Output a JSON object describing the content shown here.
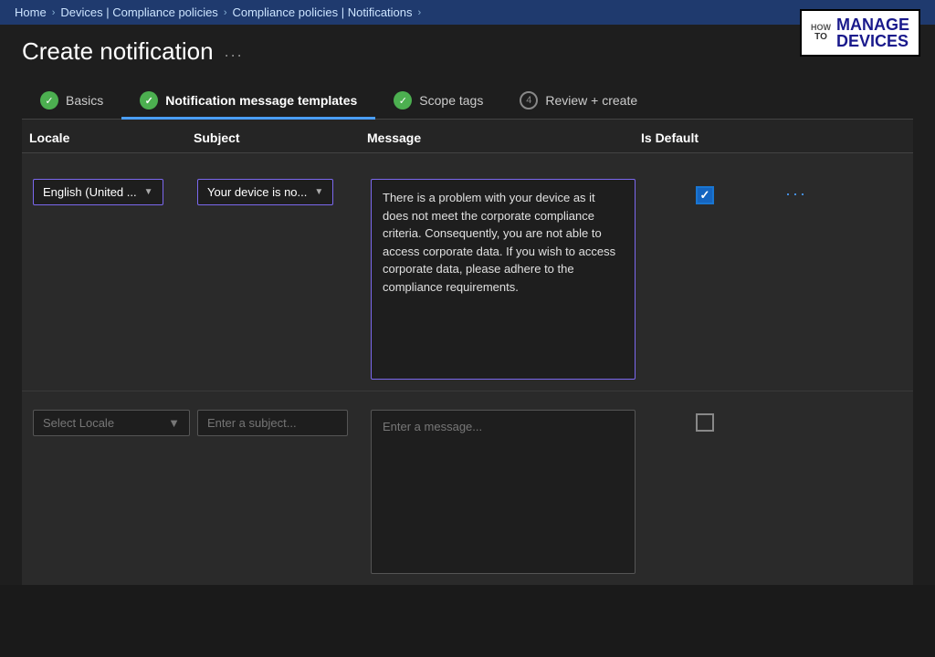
{
  "topbar": {
    "breadcrumbs": [
      "Home",
      "Devices | Compliance policies",
      "Compliance policies | Notifications"
    ]
  },
  "header": {
    "title": "Create notification",
    "ellipsis": "..."
  },
  "logo": {
    "how": "HOW",
    "to": "TO",
    "manage": "MANAGE",
    "devices": "DEVICES"
  },
  "tabs": [
    {
      "id": "basics",
      "label": "Basics",
      "state": "check",
      "active": false
    },
    {
      "id": "notification-templates",
      "label": "Notification message templates",
      "state": "check",
      "active": true
    },
    {
      "id": "scope-tags",
      "label": "Scope tags",
      "state": "check",
      "active": false
    },
    {
      "id": "review-create",
      "label": "Review + create",
      "state": "number",
      "number": "4",
      "active": false
    }
  ],
  "table": {
    "headers": [
      "Locale",
      "Subject",
      "Message",
      "Is Default",
      ""
    ],
    "rows": [
      {
        "locale_value": "English (United ...",
        "subject_value": "Your device is no...",
        "message_value": "There is a problem with your device as it does not meet the corporate compliance criteria. Consequently, you are not able to access corporate data. If you wish to access corporate data, please adhere to the compliance requirements.",
        "is_default": true,
        "has_dots": true
      }
    ],
    "new_row": {
      "locale_placeholder": "Select Locale",
      "subject_placeholder": "Enter a subject...",
      "message_placeholder": "Enter a message...",
      "is_default": false
    }
  }
}
